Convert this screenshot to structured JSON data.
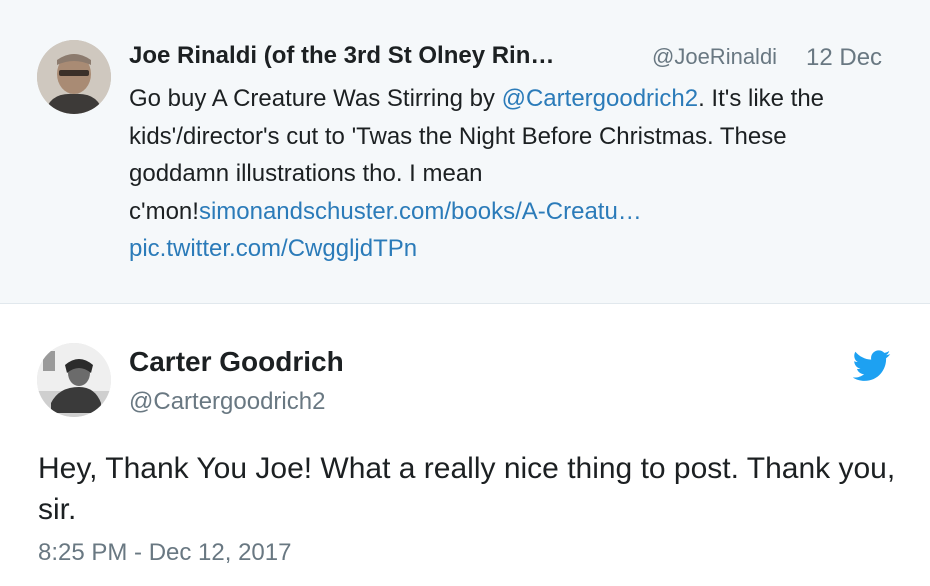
{
  "parent_tweet": {
    "author_name": "Joe Rinaldi (of the 3rd St Olney Rin…",
    "handle": "@JoeRinaldi",
    "date": "12 Dec",
    "text_before_mention": "Go buy A Creature Was Stirring by ",
    "mention": "@Cartergoodrich2",
    "text_after_mention": ". It's like the kids'/director's cut to 'Twas the Night Before Christmas. These goddamn illustrations tho. I mean c'mon!",
    "link": "simonandschuster.com/books/A-Creatu…",
    "pic_link": "pic.twitter.com/CwggljdTPn",
    "avatar_icon": "user-avatar-icon"
  },
  "reply_tweet": {
    "author_name": "Carter Goodrich",
    "handle": "@Cartergoodrich2",
    "text": "Hey, Thank You Joe! What a really nice thing to post. Thank you, sir.",
    "timestamp": "8:25 PM - Dec 12, 2017",
    "avatar_icon": "user-avatar-icon",
    "brand_icon": "twitter-bird-icon"
  },
  "colors": {
    "link": "#2b7bb9",
    "meta": "#697882",
    "parent_bg": "#f5f8fa",
    "twitter_blue": "#1da1f2"
  }
}
